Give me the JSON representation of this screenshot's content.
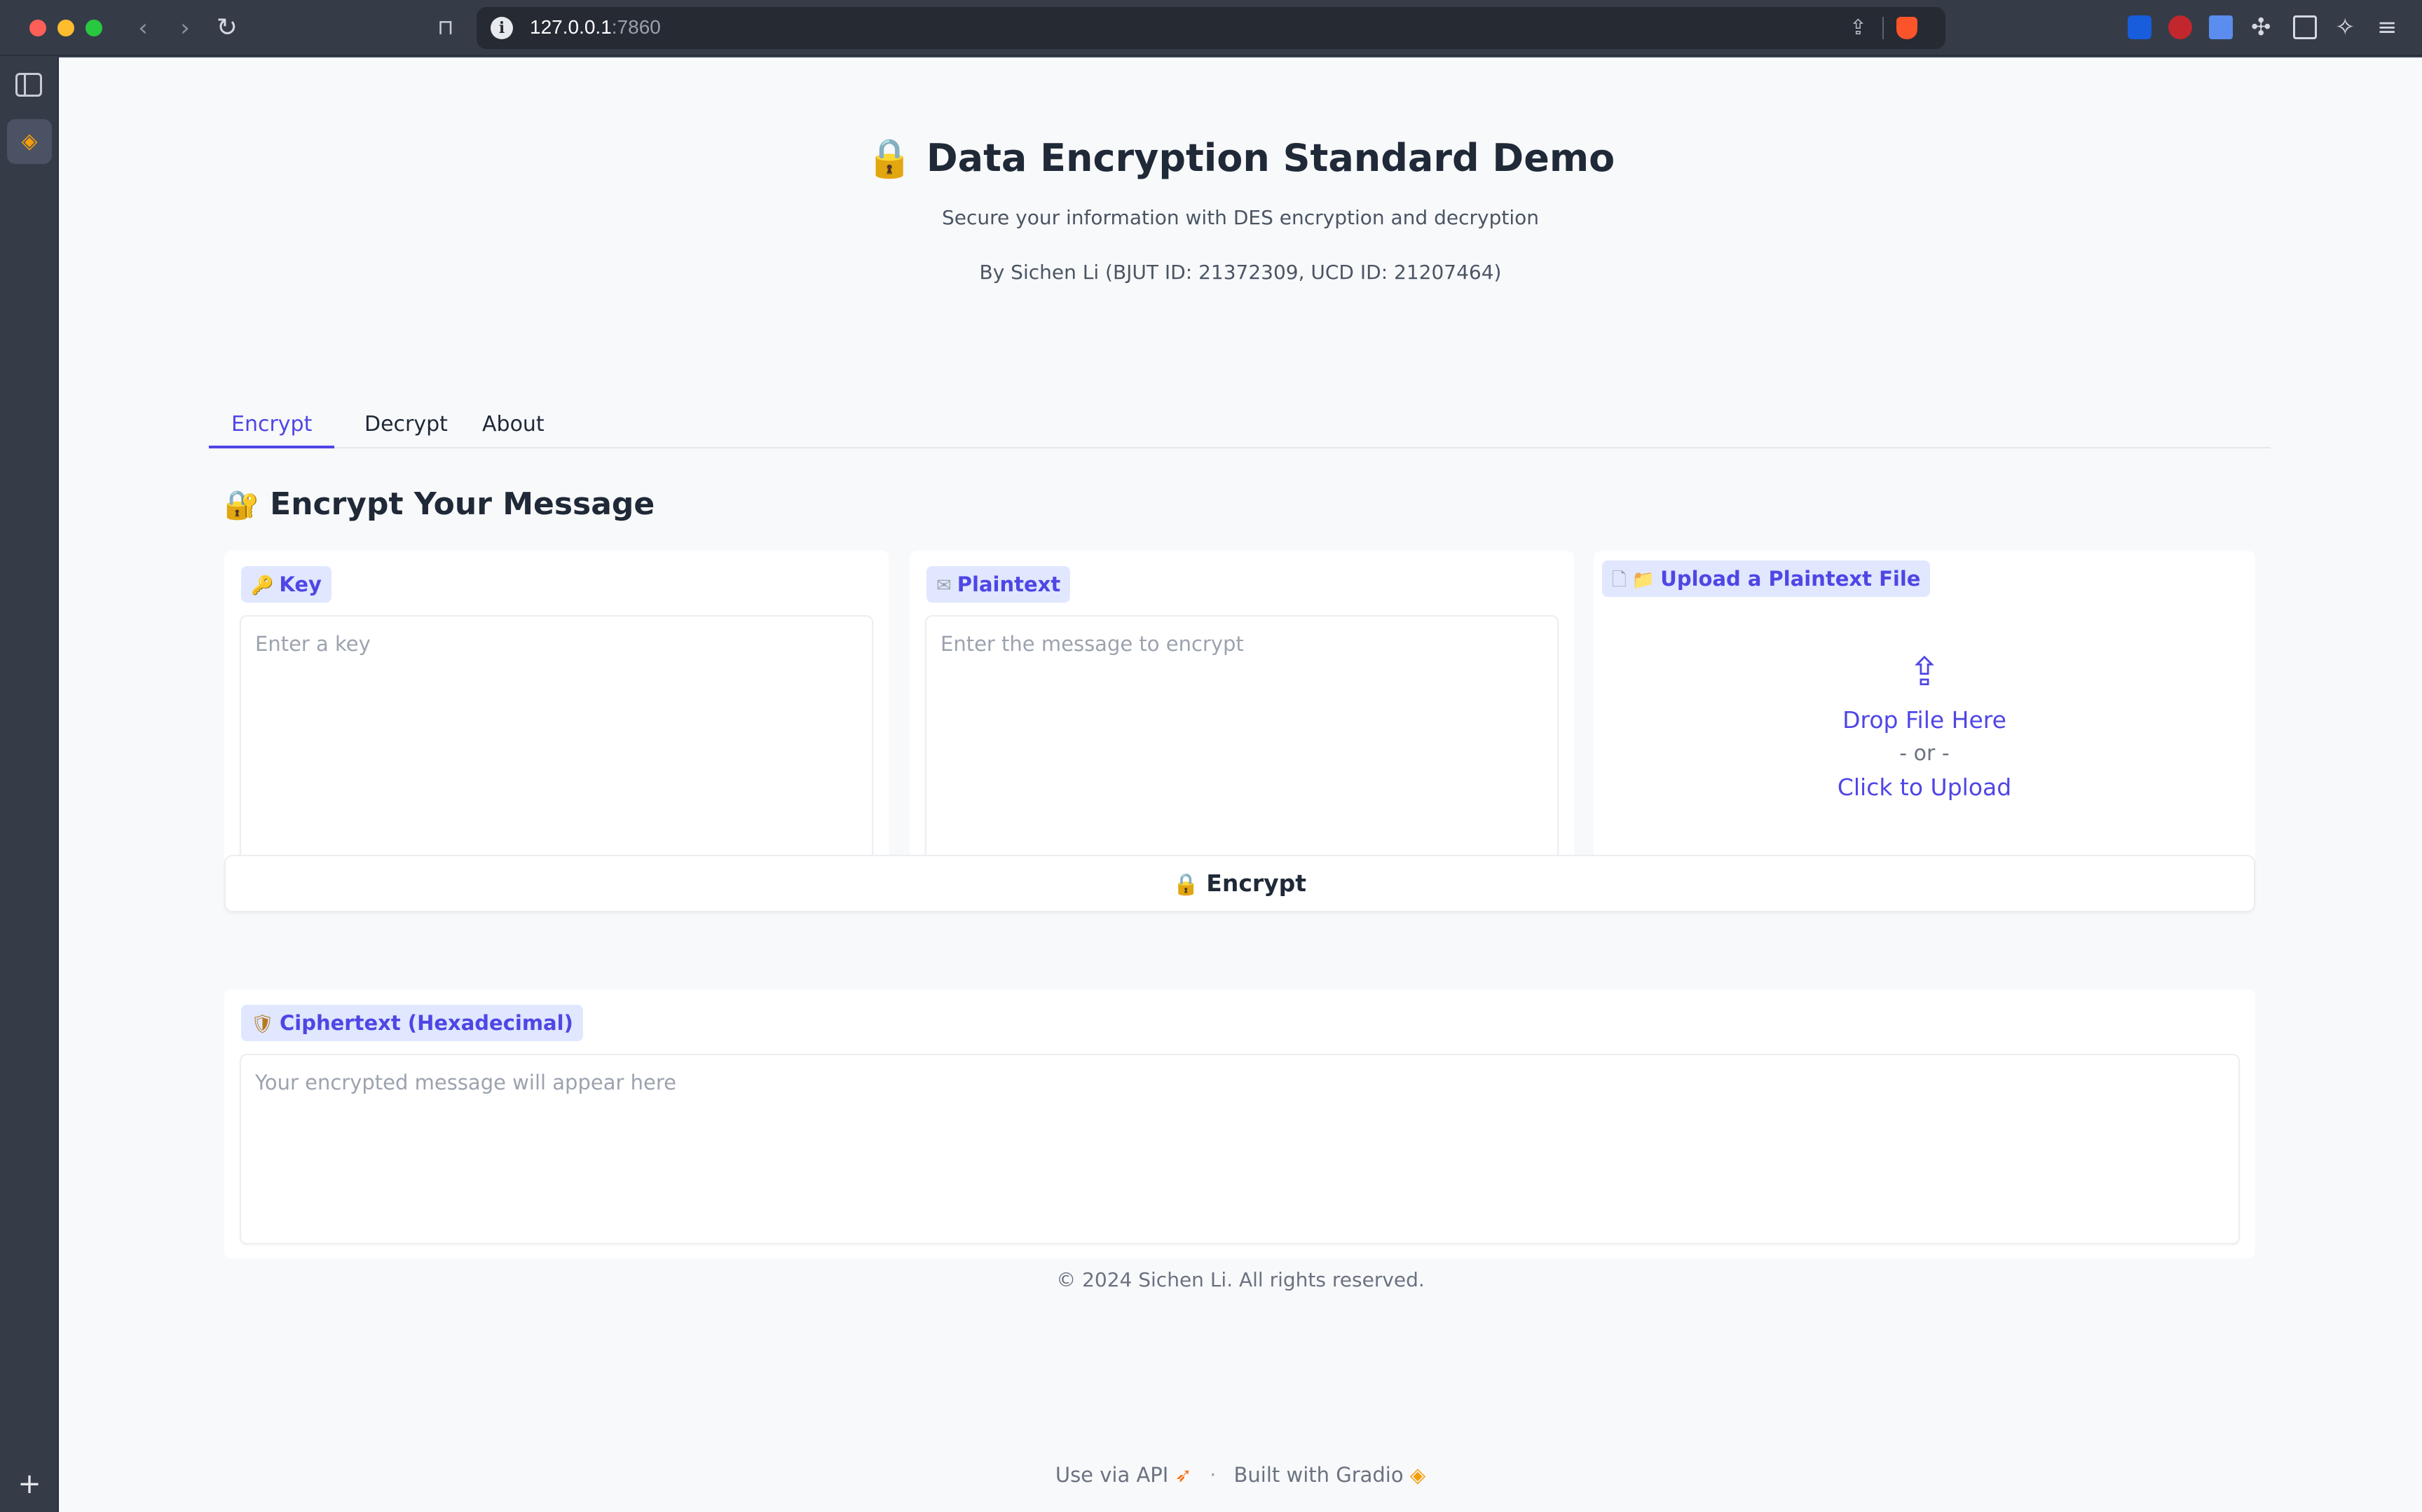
{
  "browser": {
    "url_host": "127.0.0.1",
    "url_port": ":7860"
  },
  "header": {
    "title_icon": "🔒",
    "title": "Data Encryption Standard Demo",
    "subtitle": "Secure your information with DES encryption and decryption",
    "byline": "By Sichen Li (BJUT ID: 21372309, UCD ID: 21207464)"
  },
  "tabs": [
    {
      "label": "Encrypt",
      "active": true
    },
    {
      "label": "Decrypt",
      "active": false
    },
    {
      "label": "About",
      "active": false
    }
  ],
  "encrypt": {
    "section_icon": "🔐",
    "section_title": "Encrypt Your Message",
    "key": {
      "icon": "🔑",
      "label": "Key",
      "placeholder": "Enter a key",
      "value": ""
    },
    "plaintext": {
      "icon": "✉",
      "label": "Plaintext",
      "placeholder": "Enter the message to encrypt",
      "value": ""
    },
    "upload": {
      "file_icon": "🗋",
      "folder_icon": "📁",
      "label": "Upload a Plaintext File",
      "drop_text": "Drop File Here",
      "or_text": "- or -",
      "click_text": "Click to Upload"
    },
    "button": {
      "icon": "🔒",
      "label": "Encrypt"
    },
    "ciphertext": {
      "icon": "🛡",
      "label": "Ciphertext (Hexadecimal)",
      "placeholder": "Your encrypted message will appear here",
      "value": ""
    }
  },
  "footer": {
    "copyright": "© 2024 Sichen Li. All rights reserved.",
    "api_link": "Use via API",
    "built_with": "Built with Gradio"
  },
  "colors": {
    "accent": "#4f46e5",
    "chip_bg": "#e0e7ff",
    "page_bg": "#f8f9fb"
  }
}
